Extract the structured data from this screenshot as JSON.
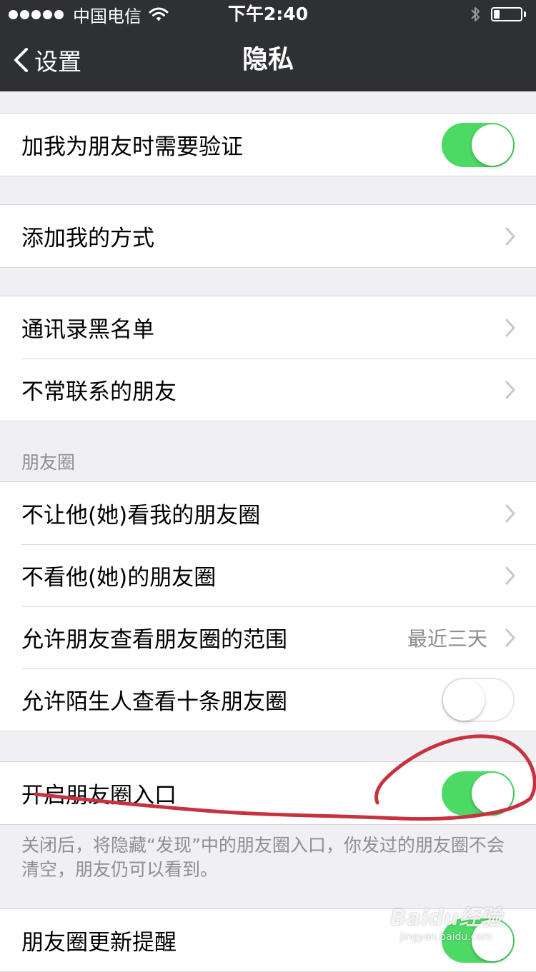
{
  "status_bar": {
    "carrier": "中国电信",
    "time": "下午2:40"
  },
  "nav": {
    "back_label": "设置",
    "title": "隐私"
  },
  "rows": {
    "verify": {
      "label": "加我为朋友时需要验证",
      "on": true
    },
    "add_method": {
      "label": "添加我的方式"
    },
    "blacklist": {
      "label": "通讯录黑名单"
    },
    "infrequent": {
      "label": "不常联系的朋友"
    },
    "hide_from": {
      "label": "不让他(她)看我的朋友圈"
    },
    "dont_see": {
      "label": "不看他(她)的朋友圈"
    },
    "range": {
      "label": "允许朋友查看朋友圈的范围",
      "detail": "最近三天"
    },
    "strangers": {
      "label": "允许陌生人查看十条朋友圈",
      "on": false
    },
    "moments_entry": {
      "label": "开启朋友圈入口",
      "on": true
    },
    "moments_updates": {
      "label": "朋友圈更新提醒",
      "on": true
    }
  },
  "section_moments": {
    "header": "朋友圈"
  },
  "moments_entry_footnote": "关闭后，将隐藏“发现”中的朋友圈入口，你发过的朋友圈不会清空，朋友仍可以看到。",
  "watermark": {
    "logo": "Baidu经验",
    "url": "jingyan.baidu.com"
  },
  "colors": {
    "nav_background": "#2e3034",
    "switch_on": "#4cd964",
    "annotation_stroke": "#c8323f"
  }
}
